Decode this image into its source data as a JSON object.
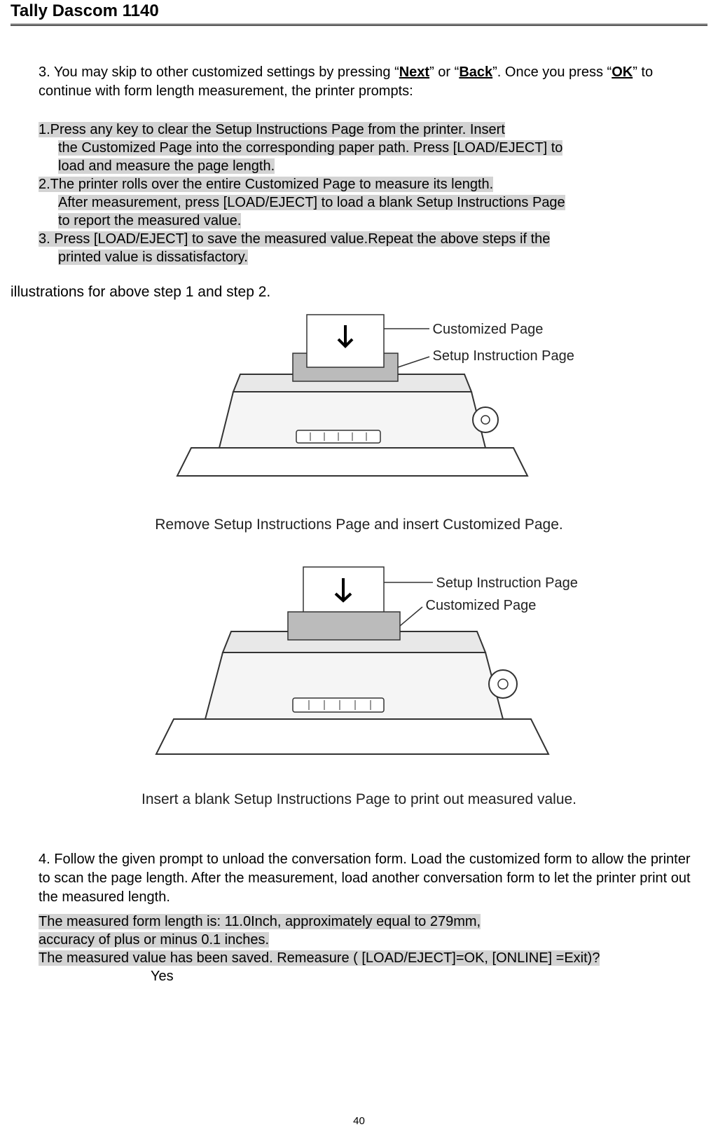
{
  "header": {
    "title": "Tally Dascom 1140"
  },
  "step3": {
    "num": "3.",
    "part1": "You may skip to other customized settings by pressing “",
    "next": "Next",
    "part2": "” or “",
    "back": "Back",
    "part3": "”. Once you press “",
    "ok": "OK",
    "part4": "” to continue with form length measurement, the printer prompts:"
  },
  "instructions": {
    "l1a": "1.Press any key to clear the Setup Instructions Page from the printer.  Insert ",
    "l1b": "the Customized Page into the corresponding paper path. Press [LOAD/EJECT] to ",
    "l1c": "load and measure the page length.",
    "l2a": "2.The printer rolls over the entire Customized Page to measure its length.",
    "l2b": "After measurement, press [LOAD/EJECT] to load a blank Setup Instructions Page ",
    "l2c": "to report the measured value.",
    "l3a": "3. Press [LOAD/EJECT] to save the measured value.Repeat the above steps if the ",
    "l3b": "printed value is dissatisfactory."
  },
  "caption_intro": "illustrations for above step 1 and step 2.",
  "fig1": {
    "label1": "Customized Page",
    "label2": "Setup Instruction Page",
    "caption": "Remove Setup Instructions Page and insert Customized Page."
  },
  "fig2": {
    "label1": "Setup Instruction Page",
    "label2": "Customized Page",
    "caption": "Insert a blank Setup Instructions Page to print out measured value."
  },
  "step4": {
    "num": "4.",
    "text": "Follow the given prompt to unload the conversation form. Load the customized form to allow the printer to scan the page length. After the measurement, load another conversation form to let the printer print out the measured length."
  },
  "result": {
    "l1": "The measured form length is: 11.0Inch, approximately equal to 279mm, ",
    "l2": "accuracy of plus or minus 0.1 inches.",
    "l3": "The measured value has been saved. Remeasure ( [LOAD/EJECT]=OK,  [ONLINE] =Exit)?  ",
    "l4": "Yes"
  },
  "page_number": "40"
}
